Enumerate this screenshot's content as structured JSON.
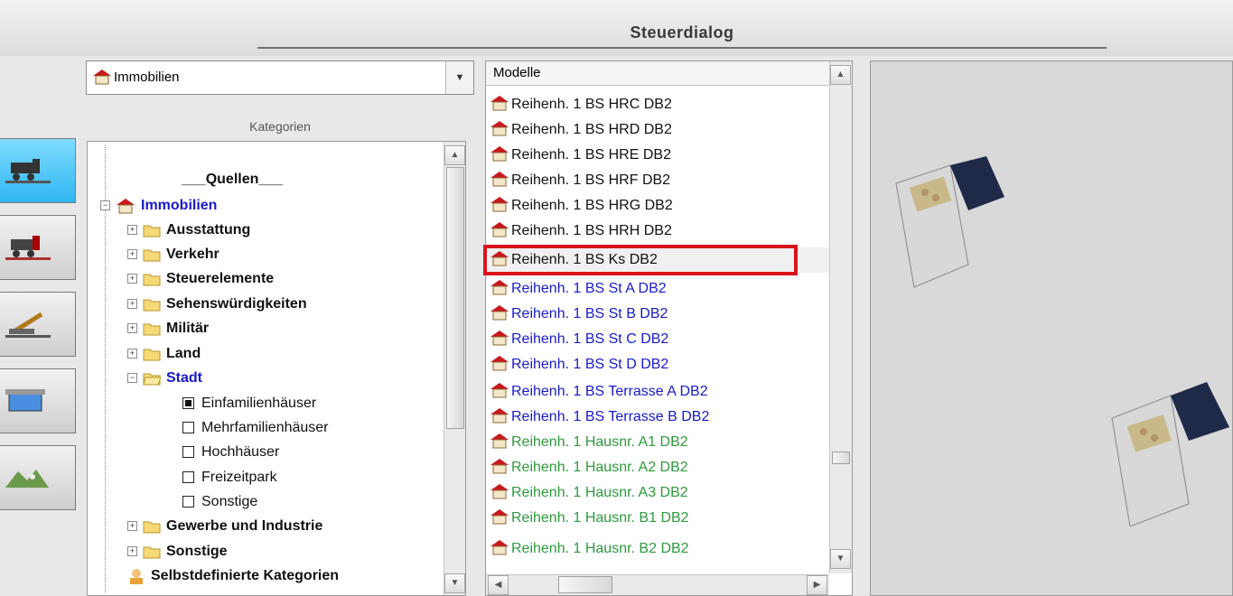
{
  "window": {
    "title": "Steuerdialog"
  },
  "dropdown": {
    "value": "Immobilien"
  },
  "categories_label": "Kategorien",
  "tree": {
    "quellen": "___Quellen___",
    "immobilien": "Immobilien",
    "items": [
      {
        "label": "Ausstattung"
      },
      {
        "label": "Verkehr"
      },
      {
        "label": "Steuerelemente"
      },
      {
        "label": "Sehenswürdigkeiten"
      },
      {
        "label": "Militär"
      },
      {
        "label": "Land"
      }
    ],
    "stadt": "Stadt",
    "stadt_children": [
      {
        "label": "Einfamilienhäuser",
        "checked": true
      },
      {
        "label": "Mehrfamilienhäuser",
        "checked": false
      },
      {
        "label": "Hochhäuser",
        "checked": false
      },
      {
        "label": "Freizeitpark",
        "checked": false
      },
      {
        "label": "Sonstige",
        "checked": false
      }
    ],
    "after": [
      {
        "label": "Gewerbe und Industrie"
      },
      {
        "label": "Sonstige"
      }
    ],
    "selbst": "Selbstdefinierte Kategorien"
  },
  "models": {
    "header": "Modelle",
    "rows": [
      {
        "label": "Reihenh. 1 BS HRC DB2",
        "color": "black"
      },
      {
        "label": "Reihenh. 1 BS HRD DB2",
        "color": "black"
      },
      {
        "label": "Reihenh. 1 BS HRE DB2",
        "color": "black"
      },
      {
        "label": "Reihenh. 1 BS HRF DB2",
        "color": "black"
      },
      {
        "label": "Reihenh. 1 BS HRG DB2",
        "color": "black"
      },
      {
        "label": "Reihenh. 1 BS HRH DB2",
        "color": "black"
      },
      {
        "label": "Reihenh. 1 BS Ks DB2",
        "color": "black",
        "selected": true
      },
      {
        "label": "Reihenh. 1 BS St A DB2",
        "color": "blue"
      },
      {
        "label": "Reihenh. 1 BS St B DB2",
        "color": "blue"
      },
      {
        "label": "Reihenh. 1 BS St C DB2",
        "color": "blue"
      },
      {
        "label": "Reihenh. 1 BS St D DB2",
        "color": "blue"
      },
      {
        "label": "Reihenh. 1 BS Terrasse A DB2",
        "color": "blue"
      },
      {
        "label": "Reihenh. 1 BS Terrasse B DB2",
        "color": "blue"
      },
      {
        "label": "Reihenh. 1 Hausnr. A1 DB2",
        "color": "green"
      },
      {
        "label": "Reihenh. 1 Hausnr. A2 DB2",
        "color": "green"
      },
      {
        "label": "Reihenh. 1 Hausnr. A3 DB2",
        "color": "green"
      },
      {
        "label": "Reihenh. 1 Hausnr. B1 DB2",
        "color": "green"
      },
      {
        "label": "Reihenh. 1 Hausnr. B2 DB2",
        "color": "green"
      }
    ]
  },
  "colors": {
    "black": "#111111",
    "blue": "#1a1ac8",
    "green": "#2e9a3e",
    "highlight": "#d8141c"
  }
}
